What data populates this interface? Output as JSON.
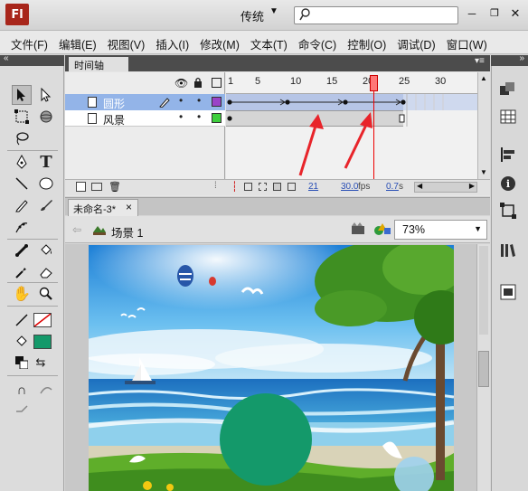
{
  "titlebar": {
    "logo": "Fl",
    "workspace": "传统",
    "search": {
      "value": "",
      "placeholder": ""
    },
    "colors": {
      "logo_bg": "#a8261b"
    }
  },
  "menubar": {
    "items": [
      "文件(F)",
      "编辑(E)",
      "视图(V)",
      "插入(I)",
      "修改(M)",
      "文本(T)",
      "命令(C)",
      "控制(O)",
      "调试(D)",
      "窗口(W)"
    ]
  },
  "timeline": {
    "tab_label": "时间轴",
    "ruler": [
      "1",
      "5",
      "10",
      "15",
      "20",
      "25",
      "30"
    ],
    "layers": [
      {
        "name": "圆形",
        "color": "#9a42c8",
        "selected": true
      },
      {
        "name": "风景",
        "color": "#3ecf3e",
        "selected": false
      }
    ],
    "current_frame": "21",
    "fps": "30.0",
    "fps_unit": "fps",
    "time": "0.7",
    "time_unit": "s"
  },
  "document": {
    "tab_label": "未命名-3*",
    "tab_close": "×",
    "scene_label": "场景 1",
    "zoom": "73%"
  },
  "stage": {
    "circle_color": "#14996a",
    "fill_swatch_color": "#14996a"
  }
}
